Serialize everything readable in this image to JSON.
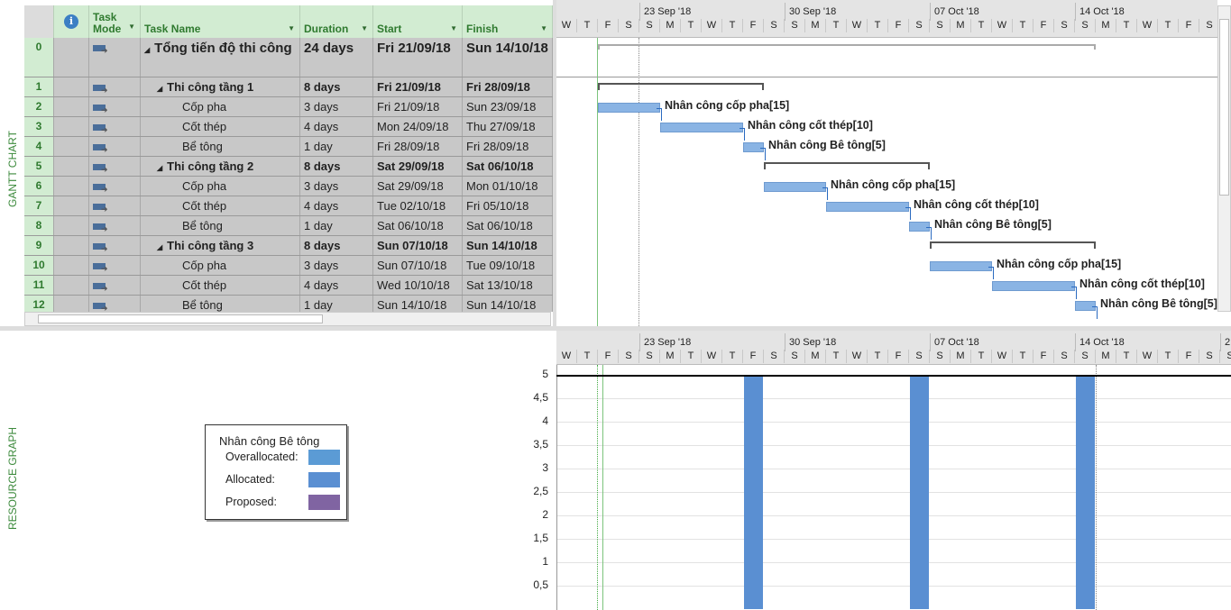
{
  "side_labels": {
    "gantt": "GANTT CHART",
    "resource": "RESOURCE GRAPH"
  },
  "columns": {
    "info": "i",
    "mode": "Task Mode",
    "name": "Task Name",
    "duration": "Duration",
    "start": "Start",
    "finish": "Finish"
  },
  "tasks": [
    {
      "id": "0",
      "name": "Tổng tiến độ thi công",
      "duration": "24 days",
      "start": "Fri 21/09/18",
      "finish": "Sun 14/10/18",
      "level": 0,
      "summary": true
    },
    {
      "id": "1",
      "name": "Thi công tầng 1",
      "duration": "8 days",
      "start": "Fri 21/09/18",
      "finish": "Fri 28/09/18",
      "level": 1,
      "summary": true
    },
    {
      "id": "2",
      "name": "Cốp pha",
      "duration": "3 days",
      "start": "Fri 21/09/18",
      "finish": "Sun 23/09/18",
      "level": 2,
      "resource": "Nhân công cốp pha[15]"
    },
    {
      "id": "3",
      "name": "Cốt thép",
      "duration": "4 days",
      "start": "Mon 24/09/18",
      "finish": "Thu 27/09/18",
      "level": 2,
      "resource": "Nhân công cốt thép[10]"
    },
    {
      "id": "4",
      "name": "Bể tông",
      "duration": "1 day",
      "start": "Fri 28/09/18",
      "finish": "Fri 28/09/18",
      "level": 2,
      "resource": "Nhân công Bê tông[5]"
    },
    {
      "id": "5",
      "name": "Thi công tầng 2",
      "duration": "8 days",
      "start": "Sat 29/09/18",
      "finish": "Sat 06/10/18",
      "level": 1,
      "summary": true
    },
    {
      "id": "6",
      "name": "Cốp pha",
      "duration": "3 days",
      "start": "Sat 29/09/18",
      "finish": "Mon 01/10/18",
      "level": 2,
      "resource": "Nhân công cốp pha[15]"
    },
    {
      "id": "7",
      "name": "Cốt thép",
      "duration": "4 days",
      "start": "Tue 02/10/18",
      "finish": "Fri 05/10/18",
      "level": 2,
      "resource": "Nhân công cốt thép[10]"
    },
    {
      "id": "8",
      "name": "Bể tông",
      "duration": "1 day",
      "start": "Sat 06/10/18",
      "finish": "Sat 06/10/18",
      "level": 2,
      "resource": "Nhân công Bê tông[5]"
    },
    {
      "id": "9",
      "name": "Thi công tầng 3",
      "duration": "8 days",
      "start": "Sun 07/10/18",
      "finish": "Sun 14/10/18",
      "level": 1,
      "summary": true
    },
    {
      "id": "10",
      "name": "Cốp pha",
      "duration": "3 days",
      "start": "Sun 07/10/18",
      "finish": "Tue 09/10/18",
      "level": 2,
      "resource": "Nhân công cốp pha[15]"
    },
    {
      "id": "11",
      "name": "Cốt thép",
      "duration": "4 days",
      "start": "Wed 10/10/18",
      "finish": "Sat 13/10/18",
      "level": 2,
      "resource": "Nhân công cốt thép[10]"
    },
    {
      "id": "12",
      "name": "Bể tông",
      "duration": "1 day",
      "start": "Sun 14/10/18",
      "finish": "Sun 14/10/18",
      "level": 2,
      "resource": "Nhân công Bê tông[5]"
    }
  ],
  "timescale": {
    "weeks": [
      "23 Sep '18",
      "30 Sep '18",
      "07 Oct '18",
      "14 Oct '18",
      "2"
    ],
    "days": [
      "W",
      "T",
      "F",
      "S",
      "S",
      "M",
      "T",
      "W",
      "T",
      "F",
      "S",
      "S",
      "M",
      "T",
      "W",
      "T",
      "F",
      "S",
      "S",
      "M",
      "T",
      "W",
      "T",
      "F",
      "S",
      "S",
      "M",
      "T",
      "W",
      "T",
      "F",
      "S",
      "S"
    ]
  },
  "resource_graph": {
    "y_ticks": [
      "5",
      "4,5",
      "4",
      "3,5",
      "3",
      "2,5",
      "2",
      "1,5",
      "1",
      "0,5"
    ],
    "max_units": 5,
    "allocations": [
      {
        "date": "28/09/18",
        "value": 5
      },
      {
        "date": "06/10/18",
        "value": 5
      },
      {
        "date": "14/10/18",
        "value": 5
      }
    ]
  },
  "legend": {
    "title": "Nhân công Bê tông",
    "items": [
      {
        "label": "Overallocated:",
        "color": "#5b9bd5"
      },
      {
        "label": "Allocated:",
        "color": "#5a8fd2"
      },
      {
        "label": "Proposed:",
        "color": "#8064a2"
      }
    ]
  }
}
